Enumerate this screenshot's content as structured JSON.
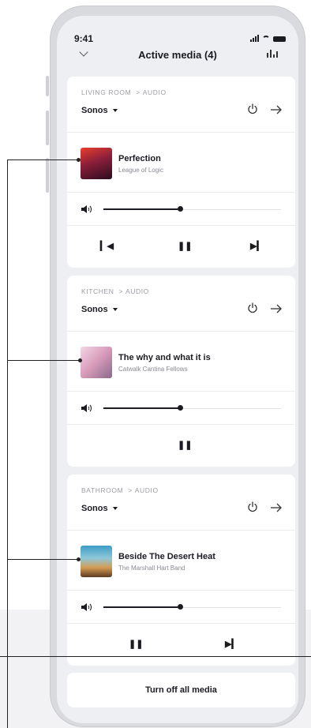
{
  "status": {
    "time": "9:41"
  },
  "header": {
    "title": "Active media (4)"
  },
  "cards": [
    {
      "crumb_room": "LIVING ROOM",
      "crumb_type": "AUDIO",
      "device": "Sonos",
      "track": "Perfection",
      "artist": "League of Logic",
      "volume_fraction": 0.44,
      "controls": [
        "previous",
        "pause",
        "next"
      ]
    },
    {
      "crumb_room": "KITCHEN",
      "crumb_type": "AUDIO",
      "device": "Sonos",
      "track": "The why and what it is",
      "artist": "Catwalk Cantina Fellows",
      "volume_fraction": 0.44,
      "controls": [
        "pause"
      ]
    },
    {
      "crumb_room": "BATHROOM",
      "crumb_type": "AUDIO",
      "device": "Sonos",
      "track": "Beside The Desert Heat",
      "artist": "The Marshall Hart Band",
      "volume_fraction": 0.44,
      "controls": [
        "pause",
        "next"
      ]
    }
  ],
  "footer": {
    "turn_off_label": "Turn off all media"
  },
  "colors": {
    "text": "#1b1b22",
    "muted": "#9b9ca3",
    "card": "#ffffff",
    "screen": "#eeeff2"
  },
  "icons": [
    "signal-icon",
    "wifi-icon",
    "battery-icon",
    "chevron-down-icon",
    "equalizer-icon",
    "power-icon",
    "arrow-right-icon",
    "volume-icon",
    "previous-icon",
    "pause-icon",
    "next-icon"
  ]
}
